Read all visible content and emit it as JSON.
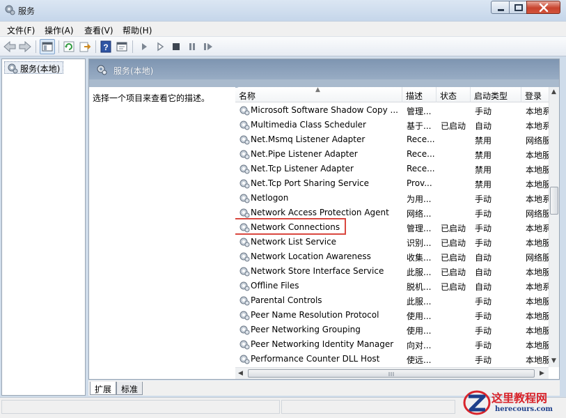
{
  "window": {
    "title": "服务"
  },
  "menu": {
    "items": [
      "文件(F)",
      "操作(A)",
      "查看(V)",
      "帮助(H)"
    ]
  },
  "tree": {
    "root_label": "服务(本地)"
  },
  "panel": {
    "title": "服务(本地)",
    "description_prompt": "选择一个项目来查看它的描述。"
  },
  "columns": {
    "name": "名称",
    "description": "描述",
    "status": "状态",
    "startup": "启动类型",
    "logon": "登录"
  },
  "services": [
    {
      "name": "Microsoft Software Shadow Copy ...",
      "description": "管理...",
      "status": "",
      "startup": "手动",
      "logon": "本地系"
    },
    {
      "name": "Multimedia Class Scheduler",
      "description": "基于...",
      "status": "已启动",
      "startup": "自动",
      "logon": "本地系"
    },
    {
      "name": "Net.Msmq Listener Adapter",
      "description": "Rece...",
      "status": "",
      "startup": "禁用",
      "logon": "网络服"
    },
    {
      "name": "Net.Pipe Listener Adapter",
      "description": "Rece...",
      "status": "",
      "startup": "禁用",
      "logon": "本地服"
    },
    {
      "name": "Net.Tcp Listener Adapter",
      "description": "Rece...",
      "status": "",
      "startup": "禁用",
      "logon": "本地服"
    },
    {
      "name": "Net.Tcp Port Sharing Service",
      "description": "Prov...",
      "status": "",
      "startup": "禁用",
      "logon": "本地服"
    },
    {
      "name": "Netlogon",
      "description": "为用...",
      "status": "",
      "startup": "手动",
      "logon": "本地系"
    },
    {
      "name": "Network Access Protection Agent",
      "description": "网络...",
      "status": "",
      "startup": "手动",
      "logon": "网络服"
    },
    {
      "name": "Network Connections",
      "description": "管理...",
      "status": "已启动",
      "startup": "手动",
      "logon": "本地系"
    },
    {
      "name": "Network List Service",
      "description": "识别...",
      "status": "已启动",
      "startup": "手动",
      "logon": "本地服"
    },
    {
      "name": "Network Location Awareness",
      "description": "收集...",
      "status": "已启动",
      "startup": "自动",
      "logon": "网络服"
    },
    {
      "name": "Network Store Interface Service",
      "description": "此服...",
      "status": "已启动",
      "startup": "自动",
      "logon": "本地服"
    },
    {
      "name": "Offline Files",
      "description": "脱机...",
      "status": "已启动",
      "startup": "自动",
      "logon": "本地系"
    },
    {
      "name": "Parental Controls",
      "description": "此服...",
      "status": "",
      "startup": "手动",
      "logon": "本地服"
    },
    {
      "name": "Peer Name Resolution Protocol",
      "description": "使用...",
      "status": "",
      "startup": "手动",
      "logon": "本地服"
    },
    {
      "name": "Peer Networking Grouping",
      "description": "使用...",
      "status": "",
      "startup": "手动",
      "logon": "本地服"
    },
    {
      "name": "Peer Networking Identity Manager",
      "description": "向对...",
      "status": "",
      "startup": "手动",
      "logon": "本地服"
    },
    {
      "name": "Performance Counter DLL Host",
      "description": "使远...",
      "status": "",
      "startup": "手动",
      "logon": "本地服"
    }
  ],
  "highlighted_service": "Network Connections",
  "tabs": {
    "extended": "扩展",
    "standard": "标准"
  },
  "watermark": {
    "site": "这里教程网",
    "url": "herecours.com"
  },
  "colors": {
    "highlight_border": "#d9473f",
    "header_blue": "#8aa0bb"
  }
}
